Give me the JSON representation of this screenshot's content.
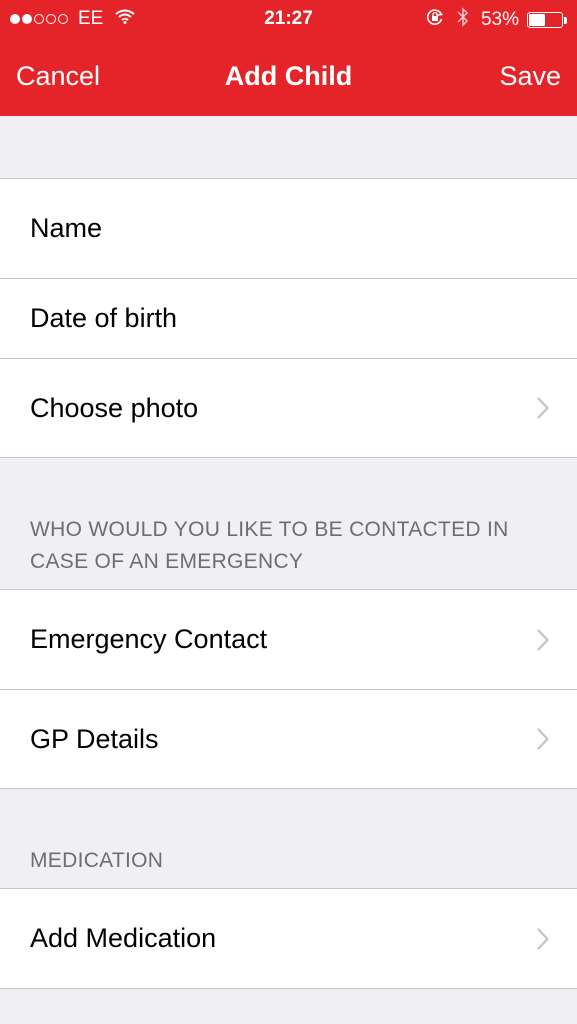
{
  "status_bar": {
    "carrier": "EE",
    "time": "21:27",
    "battery_percent": "53%",
    "battery_level": 0.53,
    "signal_bars": 2,
    "signal_total": 5,
    "icons": [
      "wifi-icon",
      "rotation-lock-icon",
      "bluetooth-icon",
      "battery-icon"
    ]
  },
  "nav": {
    "cancel_label": "Cancel",
    "title": "Add Child",
    "save_label": "Save"
  },
  "groups": {
    "child_info": {
      "rows": [
        {
          "label": "Name"
        },
        {
          "label": "Date of birth"
        },
        {
          "label": "Choose photo"
        }
      ]
    },
    "emergency": {
      "header": "WHO WOULD YOU LIKE TO BE CONTACTED IN CASE OF AN EMERGENCY",
      "rows": [
        {
          "label": "Emergency Contact"
        },
        {
          "label": "GP Details"
        }
      ]
    },
    "medication": {
      "header": "MEDICATION",
      "rows": [
        {
          "label": "Add Medication"
        }
      ]
    }
  },
  "colors": {
    "brand_red": "#e5242a",
    "background": "#efeff4",
    "separator": "#c8c7cc",
    "section_header": "#6d6d72",
    "chevron": "#c7c7cc"
  }
}
